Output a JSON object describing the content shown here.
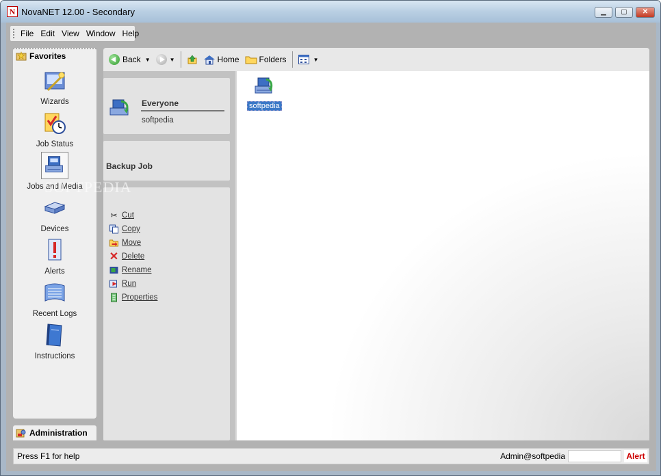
{
  "window": {
    "title": "NovaNET 12.00 - Secondary",
    "controls": {
      "minimize": "▁",
      "maximize": "▢",
      "close": "✕"
    }
  },
  "menubar": [
    "File",
    "Edit",
    "View",
    "Window",
    "Help"
  ],
  "favorites": {
    "title": "Favorites",
    "items": [
      {
        "label": "Wizards",
        "icon": "wizards-icon"
      },
      {
        "label": "Job Status",
        "icon": "job-status-icon"
      },
      {
        "label": "Jobs and Media",
        "icon": "jobs-media-icon"
      },
      {
        "label": "Devices",
        "icon": "devices-icon"
      },
      {
        "label": "Alerts",
        "icon": "alerts-icon"
      },
      {
        "label": "Recent Logs",
        "icon": "recent-logs-icon"
      },
      {
        "label": "Instructions",
        "icon": "instructions-icon"
      }
    ]
  },
  "administration": {
    "label": "Administration"
  },
  "toolbar": {
    "back": "Back",
    "home": "Home",
    "folders": "Folders"
  },
  "user_card": {
    "name": "Everyone",
    "sub": "softpedia"
  },
  "job_card": {
    "title": "Backup Job"
  },
  "actions": [
    "Cut",
    "Copy",
    "Move",
    "Delete",
    "Rename",
    "Run",
    "Properties"
  ],
  "content": {
    "items": [
      {
        "label": "softpedia"
      }
    ],
    "watermark": "SOFTPEDIA"
  },
  "statusbar": {
    "help": "Press F1 for help",
    "user": "Admin@softpedia",
    "alert": "Alert"
  },
  "colors": {
    "selection": "#3a78c7",
    "alert": "#cc0000"
  }
}
